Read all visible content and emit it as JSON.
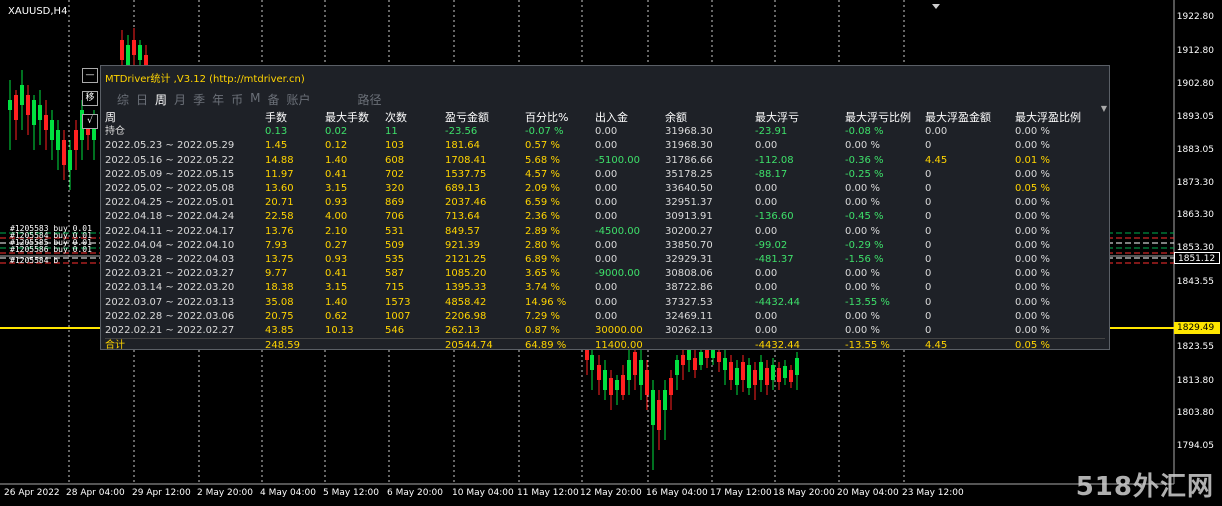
{
  "chart": {
    "symbol": "XAUUSD,H4",
    "price_labels": [
      "1922.80",
      "1912.80",
      "1902.80",
      "1893.05",
      "1883.05",
      "1873.30",
      "1863.30",
      "1853.30",
      "1843.55",
      "1823.55",
      "1813.80",
      "1803.80",
      "1794.05"
    ],
    "current_prices": {
      "upper": "1851.12",
      "lower": "1829.49"
    },
    "date_labels": [
      "26 Apr 2022",
      "28 Apr 04:00",
      "29 Apr 12:00",
      "2 May 20:00",
      "4 May 04:00",
      "5 May 12:00",
      "6 May 20:00",
      "10 May 04:00",
      "11 May 12:00",
      "12 May 20:00",
      "16 May 04:00",
      "17 May 12:00",
      "18 May 20:00",
      "20 May 04:00",
      "23 May 12:00"
    ],
    "order_lines": [
      "#1205583 buy 0.01",
      "#1205584 buy 0.01",
      "#1205585 buy 0.01",
      "#1205586 buy 0.01"
    ],
    "order_short": "#1205584 b",
    "colors": {
      "bull": "#00e040",
      "bear": "#ff2020",
      "grid": "#ffffff",
      "yellow_line": "#ffe600"
    }
  },
  "watermark": "518外汇网",
  "side_buttons": {
    "minimize": "—",
    "menu": "移",
    "check": "√"
  },
  "panel": {
    "title": "MTDriver统计 ,V3.12 (http://mtdriver.cn)",
    "tabs": [
      "综",
      "日",
      "周",
      "月",
      "季",
      "年",
      "币",
      "M",
      "备",
      "账户",
      "路径"
    ],
    "active_tab": "周",
    "headers": [
      "周",
      "手数",
      "最大手数",
      "次数",
      "盈亏金额",
      "百分比%",
      "出入金",
      "余额",
      "最大浮亏",
      "最大浮亏比例",
      "最大浮盈金额",
      "最大浮盈比例"
    ],
    "rows": [
      [
        "持仓",
        "0.13",
        "0.02",
        "11",
        "-23.56",
        "-0.07 %",
        "0.00",
        "31968.30",
        "-23.91",
        "-0.08 %",
        "0.00",
        "0.00 %"
      ],
      [
        "2022.05.23 ~ 2022.05.29",
        "1.45",
        "0.12",
        "103",
        "181.64",
        "0.57 %",
        "0.00",
        "31968.30",
        "0.00",
        "0.00 %",
        "0",
        "0.00 %"
      ],
      [
        "2022.05.16 ~ 2022.05.22",
        "14.88",
        "1.40",
        "608",
        "1708.41",
        "5.68 %",
        "-5100.00",
        "31786.66",
        "-112.08",
        "-0.36 %",
        "4.45",
        "0.01 %"
      ],
      [
        "2022.05.09 ~ 2022.05.15",
        "11.97",
        "0.41",
        "702",
        "1537.75",
        "4.57 %",
        "0.00",
        "35178.25",
        "-88.17",
        "-0.25 %",
        "0",
        "0.00 %"
      ],
      [
        "2022.05.02 ~ 2022.05.08",
        "13.60",
        "3.15",
        "320",
        "689.13",
        "2.09 %",
        "0.00",
        "33640.50",
        "0.00",
        "0.00 %",
        "0",
        "0.05 %"
      ],
      [
        "2022.04.25 ~ 2022.05.01",
        "20.71",
        "0.93",
        "869",
        "2037.46",
        "6.59 %",
        "0.00",
        "32951.37",
        "0.00",
        "0.00 %",
        "0",
        "0.00 %"
      ],
      [
        "2022.04.18 ~ 2022.04.24",
        "22.58",
        "4.00",
        "706",
        "713.64",
        "2.36 %",
        "0.00",
        "30913.91",
        "-136.60",
        "-0.45 %",
        "0",
        "0.00 %"
      ],
      [
        "2022.04.11 ~ 2022.04.17",
        "13.76",
        "2.10",
        "531",
        "849.57",
        "2.89 %",
        "-4500.00",
        "30200.27",
        "0.00",
        "0.00 %",
        "0",
        "0.00 %"
      ],
      [
        "2022.04.04 ~ 2022.04.10",
        "7.93",
        "0.27",
        "509",
        "921.39",
        "2.80 %",
        "0.00",
        "33850.70",
        "-99.02",
        "-0.29 %",
        "0",
        "0.00 %"
      ],
      [
        "2022.03.28 ~ 2022.04.03",
        "13.75",
        "0.93",
        "535",
        "2121.25",
        "6.89 %",
        "0.00",
        "32929.31",
        "-481.37",
        "-1.56 %",
        "0",
        "0.00 %"
      ],
      [
        "2022.03.21 ~ 2022.03.27",
        "9.77",
        "0.41",
        "587",
        "1085.20",
        "3.65 %",
        "-9000.00",
        "30808.06",
        "0.00",
        "0.00 %",
        "0",
        "0.00 %"
      ],
      [
        "2022.03.14 ~ 2022.03.20",
        "18.38",
        "3.15",
        "715",
        "1395.33",
        "3.74 %",
        "0.00",
        "38722.86",
        "0.00",
        "0.00 %",
        "0",
        "0.00 %"
      ],
      [
        "2022.03.07 ~ 2022.03.13",
        "35.08",
        "1.40",
        "1573",
        "4858.42",
        "14.96 %",
        "0.00",
        "37327.53",
        "-4432.44",
        "-13.55 %",
        "0",
        "0.00 %"
      ],
      [
        "2022.02.28 ~ 2022.03.06",
        "20.75",
        "0.62",
        "1007",
        "2206.98",
        "7.29 %",
        "0.00",
        "32469.11",
        "0.00",
        "0.00 %",
        "0",
        "0.00 %"
      ],
      [
        "2022.02.21 ~ 2022.02.27",
        "43.85",
        "10.13",
        "546",
        "262.13",
        "0.87 %",
        "30000.00",
        "30262.13",
        "0.00",
        "0.00 %",
        "0",
        "0.00 %"
      ]
    ],
    "total": [
      "合计",
      "248.59",
      "",
      "",
      "20544.74",
      "64.89 %",
      "11400.00",
      "",
      "-4432.44",
      "-13.55 %",
      "4.45",
      "0.05 %"
    ]
  }
}
